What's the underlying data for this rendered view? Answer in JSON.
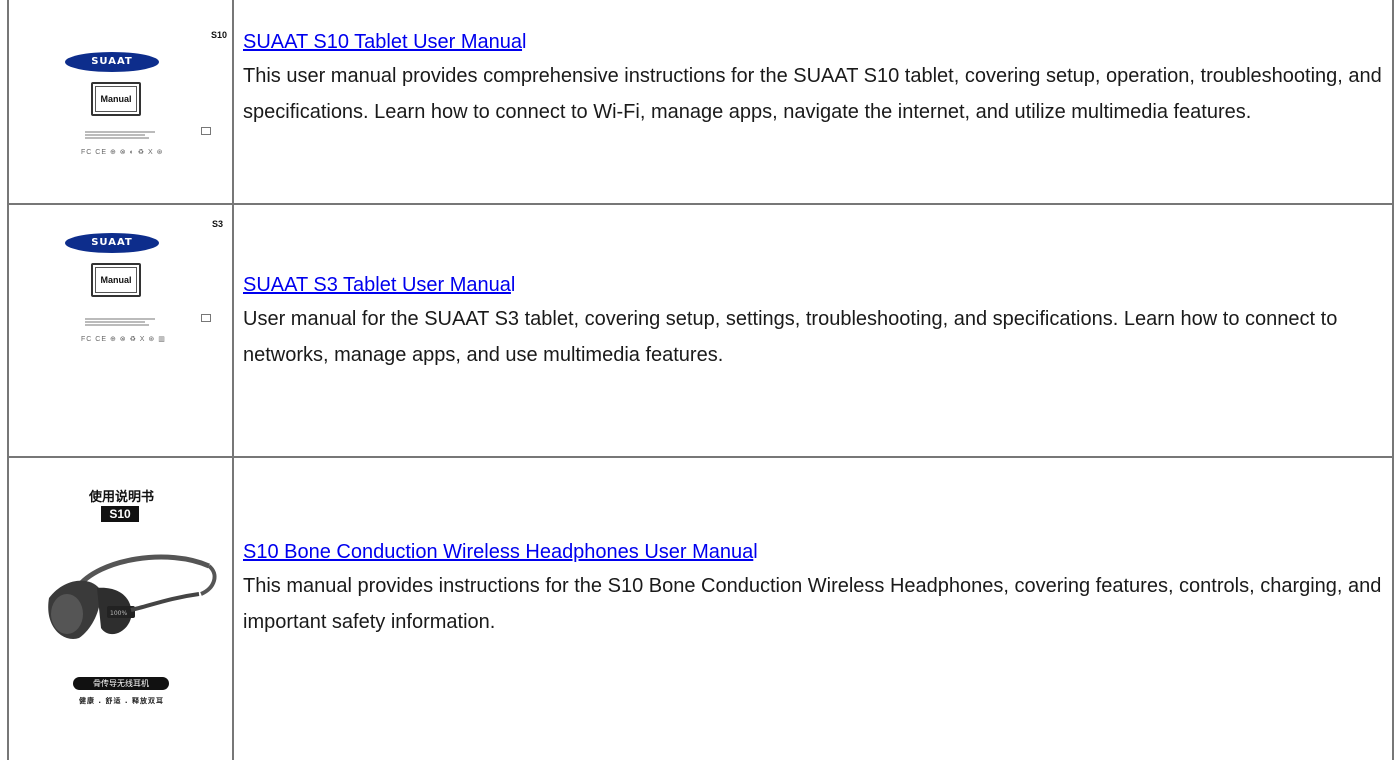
{
  "rows": [
    {
      "title": "SUAAT S10 Tablet User Manua",
      "title_tail": "l",
      "description": "This user manual provides comprehensive instructions for the SUAAT S10 tablet, covering setup, operation, troubleshooting, and specifications. Learn how to connect to Wi-Fi, manage apps, navigate the internet, and utilize multimedia features.",
      "cover": {
        "model": "S10",
        "logo": "SUAAT",
        "box_label": "Manual",
        "cert": "FC CE ⊕ ⊗ ◐ ♻ X ⊛"
      }
    },
    {
      "title": "SUAAT S3 Tablet User Manua",
      "title_tail": "l",
      "description": "User manual for the SUAAT S3 tablet, covering setup, settings, troubleshooting, and specifications. Learn how to connect to networks, manage apps, and use multimedia features.",
      "cover": {
        "model": "S3",
        "logo": "SUAAT",
        "box_label": "Manual",
        "cert": "FC CE ⊕ ⊗ ♻ X ⊛ ▥"
      }
    },
    {
      "title": "S10 Bone Conduction Wireless Headphones User Manua",
      "title_tail": "l",
      "description": "This manual provides instructions for the S10 Bone Conduction Wireless Headphones, covering features, controls, charging, and important safety information.",
      "cover": {
        "heading": "使用说明书",
        "model": "S10",
        "pill": "骨传导无线耳机",
        "subtitle": "健康 . 舒适 . 释放双耳"
      }
    }
  ],
  "colors": {
    "link": "#0000ee",
    "border": "#777777",
    "logo": "#0d2d8c"
  }
}
